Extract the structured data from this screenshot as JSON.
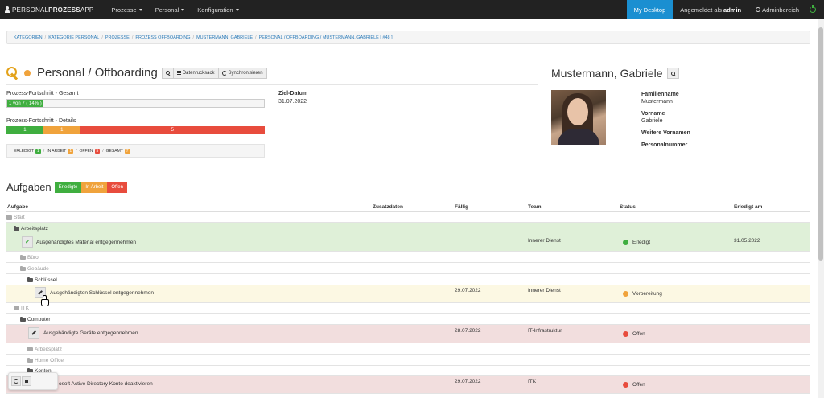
{
  "nav": {
    "brand_light": "PERSONAL",
    "brand_bold": "PROZESS",
    "brand_suffix": "APP",
    "menu": [
      "Prozesse",
      "Personal",
      "Konfiguration"
    ],
    "my_desktop": "My Desktop",
    "logged_in_prefix": "Angemeldet als ",
    "logged_in_user": "admin",
    "admin_area": "Adminbereich"
  },
  "breadcrumb": [
    "KATEGORIEN",
    "KATEGORIE PERSONAL",
    "PROZESSE",
    "PROZESS OFFBOARDING",
    "MUSTERMANN, GABRIELE",
    "PERSONAL / OFFBOARDING / MUSTERMANN, GABRIELE [ #48 ]"
  ],
  "header": {
    "title": "Personal / Offboarding",
    "btn_data_back": "Datenrucksack",
    "btn_sync": "Synchronisieren"
  },
  "progress": {
    "total_label": "Prozess-Fortschritt - Gesamt",
    "total_text": "1 von 7 ( 14% )",
    "total_fraction": 0.14,
    "detail_label": "Prozess-Fortschritt - Details",
    "done": 1,
    "in_progress": 1,
    "open": 5
  },
  "legend": {
    "erledigt": "ERLEDIGT",
    "erledigt_count": "1",
    "in_arbeit": "IN ARBEIT",
    "in_arbeit_count": "1",
    "offen": "OFFEN",
    "offen_count": "5",
    "gesamt": "GESAMT",
    "gesamt_count": "7"
  },
  "target": {
    "label": "Ziel-Datum",
    "value": "31.07.2022"
  },
  "profile": {
    "name": "Mustermann, Gabriele",
    "familienname_label": "Familienname",
    "familienname": "Mustermann",
    "vorname_label": "Vorname",
    "vorname": "Gabriele",
    "weitere_label": "Weitere Vornamen",
    "personalnummer_label": "Personalnummer"
  },
  "colors": {
    "done": "#3fae3f",
    "in_progress": "#f0a33c",
    "open": "#e84c3d",
    "row_done": "#dff0d8",
    "row_progress": "#fcf8e3",
    "row_open": "#f2dede"
  },
  "tasks": {
    "title": "Aufgaben",
    "filter_done": "Erledigte",
    "filter_progress": "In Arbeit",
    "filter_open": "Offen",
    "columns": {
      "aufgabe": "Aufgabe",
      "zusatzdaten": "Zusatzdaten",
      "faellig": "Fällig",
      "team": "Team",
      "status": "Status",
      "erledigt_am": "Erledigt am"
    },
    "nodes": {
      "start": "Start",
      "arbeitsplatz": "Arbeitsplatz",
      "buero": "Büro",
      "gebaeude": "Gebäude",
      "schluessel": "Schlüssel",
      "itk": "ITK",
      "computer": "Computer",
      "arbeitsplatz2": "Arbeitsplatz",
      "home_office": "Home Office",
      "konten": "Konten"
    },
    "task1": {
      "name": "Ausgehändigtes Material entgegennehmen",
      "due": "",
      "team": "Innerer Dienst",
      "status": "Erledigt",
      "done_on": "31.05.2022"
    },
    "task2": {
      "name": "Ausgehändigten Schlüssel entgegennehmen",
      "due": "29.07.2022",
      "team": "Innerer Dienst",
      "status": "Vorbereitung",
      "done_on": ""
    },
    "task3": {
      "name": "Ausgehändigte Geräte entgegennehmen",
      "due": "28.07.2022",
      "team": "IT-Infrastruktur",
      "status": "Offen",
      "done_on": ""
    },
    "task4": {
      "name": "osoft Active Directory Konto deaktivieren",
      "due": "29.07.2022",
      "team": "ITK",
      "status": "Offen",
      "done_on": ""
    }
  }
}
